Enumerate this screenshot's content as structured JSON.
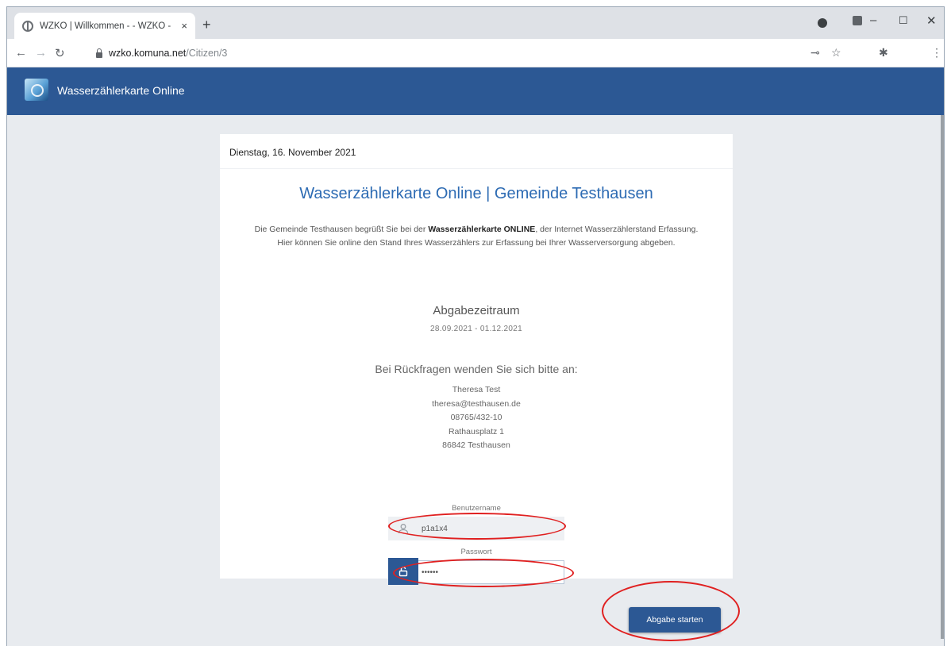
{
  "browser": {
    "tab_title": "WZKO | Willkommen - - WZKO -",
    "tab_close": "×",
    "new_tab": "+",
    "url_host": "wzko.komuna.net",
    "url_path": "/Citizen/3"
  },
  "app": {
    "title": "Wasserzählerkarte Online"
  },
  "page": {
    "date": "Dienstag, 16. November 2021",
    "heading": "Wasserzählerkarte Online | Gemeinde Testhausen",
    "intro_before": "Die Gemeinde Testhausen begrüßt Sie bei der ",
    "intro_bold": "Wasserzählerkarte ONLINE",
    "intro_after": ", der Internet Wasserzählerstand Erfassung.",
    "intro_line2": "Hier können Sie online den Stand Ihres Wasserzählers zur Erfassung bei Ihrer Wasserversorgung abgeben.",
    "period_title": "Abgabezeitraum",
    "period_range": "28.09.2021 - 01.12.2021",
    "contact_title": "Bei Rückfragen wenden Sie sich bitte an:",
    "contact": {
      "name": "Theresa Test",
      "email": "theresa@testhausen.de",
      "phone": "08765/432-10",
      "street": "Rathausplatz 1",
      "city": "86842 Testhausen"
    }
  },
  "login": {
    "username_label": "Benutzername",
    "username_value": "p1a1x4",
    "password_label": "Passwort",
    "password_value": "••••••",
    "submit_label": "Abgabe starten"
  },
  "colors": {
    "header": "#2c5894",
    "heading": "#2d6bb3",
    "annotation": "#e02020"
  }
}
